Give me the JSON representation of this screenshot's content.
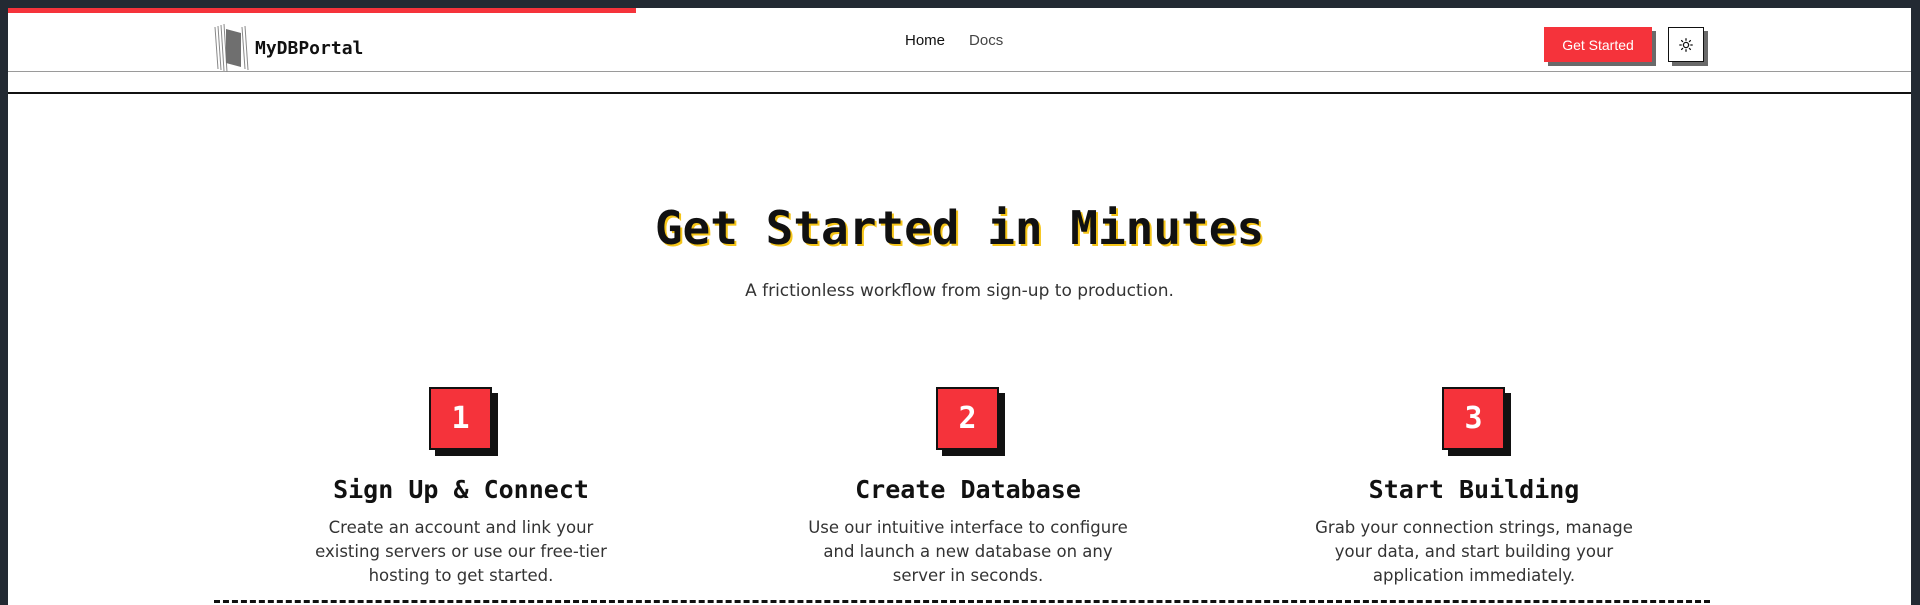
{
  "progress": {
    "fraction": 0.33,
    "color": "#f5333b"
  },
  "header": {
    "logo_text": "MyDBPortal",
    "nav": [
      {
        "label": "Home",
        "active": true
      },
      {
        "label": "Docs",
        "active": false
      }
    ],
    "cta_label": "Get Started",
    "theme_icon": "sun-icon"
  },
  "hero": {
    "title": "Get Started in Minutes",
    "subtitle": "A frictionless workflow from sign-up to production."
  },
  "steps": [
    {
      "number": "1",
      "title": "Sign Up & Connect",
      "desc_lines": [
        "Create an account and link your",
        "existing servers or use our free-tier",
        "hosting to get started."
      ]
    },
    {
      "number": "2",
      "title": "Create Database",
      "desc_lines": [
        "Use our intuitive interface to configure",
        "and launch a new database on any",
        "server in seconds."
      ]
    },
    {
      "number": "3",
      "title": "Start Building",
      "desc_lines": [
        "Grab your connection strings, manage",
        "your data, and start building your",
        "application immediately."
      ]
    }
  ],
  "colors": {
    "accent": "#f5333b",
    "title_shadow": "#f5c518",
    "ink": "#111111"
  }
}
